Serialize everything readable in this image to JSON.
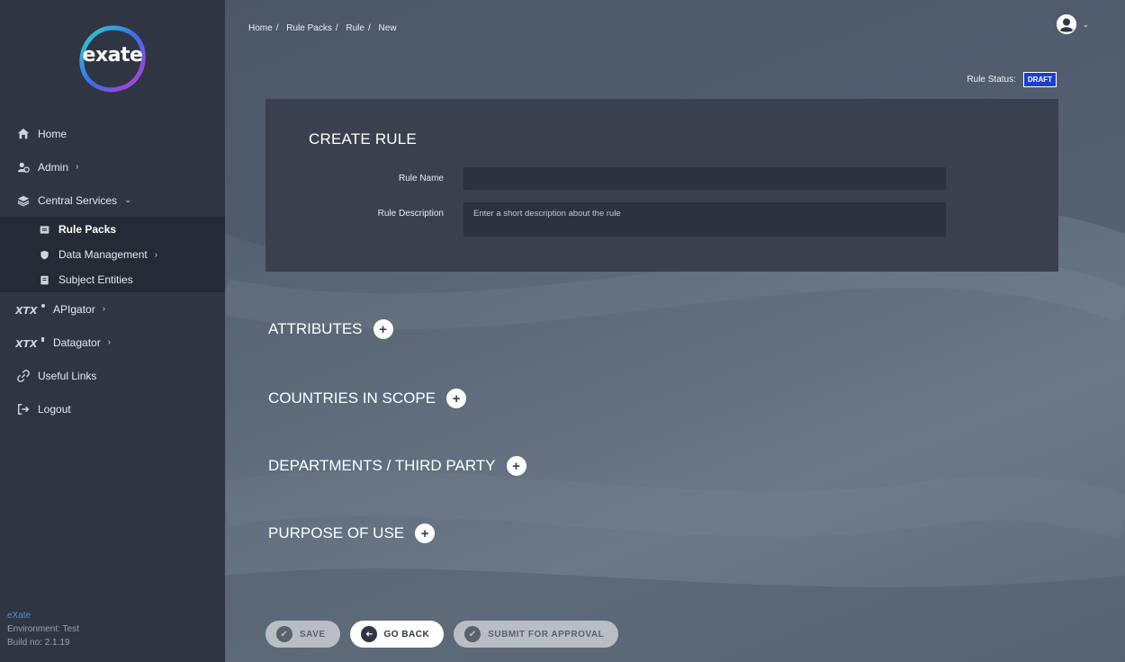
{
  "sidebar": {
    "logo_text": "exate",
    "items": [
      {
        "label": "Home",
        "icon": "home-icon"
      },
      {
        "label": "Admin",
        "icon": "users-icon",
        "chevron": "›"
      },
      {
        "label": "Central Services",
        "icon": "layers-icon",
        "chevron": "⌄"
      }
    ],
    "sub_items": [
      {
        "label": "Rule Packs",
        "icon": "list-icon"
      },
      {
        "label": "Data Management",
        "icon": "shield-icon",
        "chevron": "›"
      },
      {
        "label": "Subject Entities",
        "icon": "book-icon"
      }
    ],
    "items2": [
      {
        "label": "APIgator",
        "icon": "apigator-logo-icon",
        "chevron": "›"
      },
      {
        "label": "Datagator",
        "icon": "datagator-logo-icon",
        "chevron": "›"
      },
      {
        "label": "Useful Links",
        "icon": "link-icon"
      },
      {
        "label": "Logout",
        "icon": "logout-icon"
      }
    ],
    "footer": {
      "company": "eXate",
      "environment": "Environment: Test",
      "build": "Build no: 2.1.19"
    }
  },
  "breadcrumb": [
    "Home",
    "Rule Packs",
    "Rule",
    "New"
  ],
  "breadcrumb_sep": "/",
  "status": {
    "label": "Rule Status:",
    "value": "DRAFT",
    "badge_color": "#1a3fd0"
  },
  "form": {
    "title": "CREATE RULE",
    "rule_name_label": "Rule Name",
    "rule_name_value": "",
    "rule_desc_label": "Rule Description",
    "rule_desc_placeholder": "Enter a short description about the rule"
  },
  "sections": [
    {
      "label": "ATTRIBUTES",
      "button": "+"
    },
    {
      "label": "COUNTRIES IN SCOPE",
      "button": "+"
    },
    {
      "label": "DEPARTMENTS / THIRD PARTY",
      "button": "+"
    },
    {
      "label": "PURPOSE OF USE",
      "button": "+"
    }
  ],
  "buttons": {
    "save": "SAVE",
    "go_back": "GO BACK",
    "submit": "SUBMIT FOR APPROVAL"
  },
  "colors": {
    "sidebar": "#2f3542",
    "card": "#3b404e",
    "accent_blue": "#1a3fd0"
  }
}
